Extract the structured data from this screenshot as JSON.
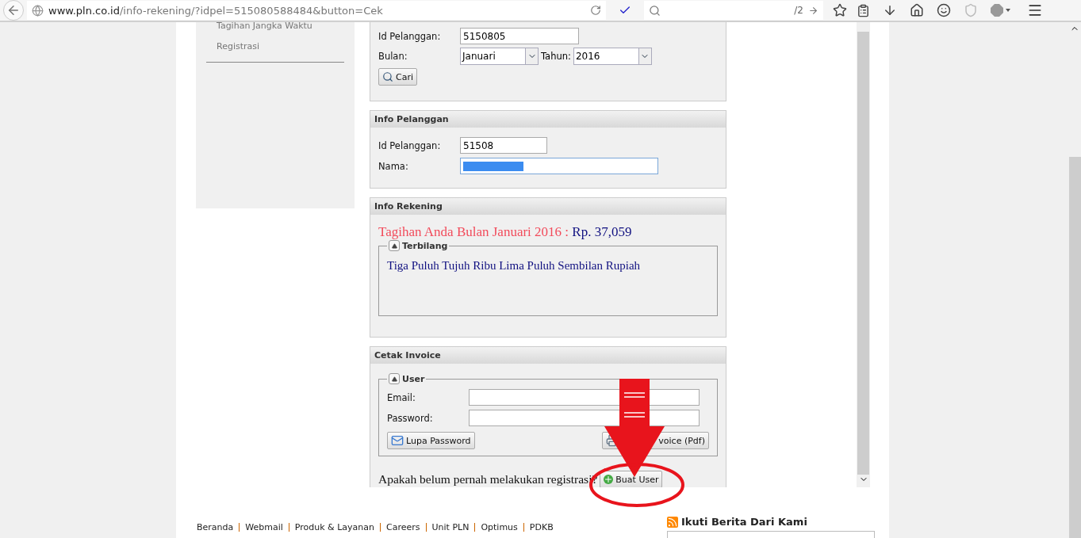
{
  "browser": {
    "url_host": "www.pln.co.id",
    "url_path": "/info-rekening/?idpel=515080588484&button=Cek",
    "search_text": "/2"
  },
  "sidebar": {
    "items": [
      "Tagihan Jangka Waktu",
      "Registrasi"
    ]
  },
  "search_form": {
    "id_label": "Id Pelanggan:",
    "id_value": "5150805",
    "month_label": "Bulan:",
    "month_value": "Januari",
    "year_label": "Tahun:",
    "year_value": "2016",
    "button": "Cari"
  },
  "info_pelanggan": {
    "title": "Info Pelanggan",
    "id_label": "Id Pelanggan:",
    "id_value": "51508",
    "name_label": "Nama:"
  },
  "info_rekening": {
    "title": "Info Rekening",
    "bill_text": "Tagihan Anda Bulan Januari 2016 :",
    "amount": "Rp. 37,059",
    "legend": "Terbilang",
    "words": "Tiga Puluh Tujuh Ribu Lima Puluh Sembilan Rupiah"
  },
  "cetak_invoice": {
    "title": "Cetak Invoice",
    "legend": "User",
    "email_label": "Email:",
    "password_label": "Password:",
    "forgot_button": "Lupa Password",
    "print_button": "voice (Pdf)",
    "register_question": "Apakah belum pernah melakukan registrasi?",
    "register_button": "Buat User"
  },
  "footer": {
    "links": [
      "Beranda",
      "Webmail",
      "Produk & Layanan",
      "Careers",
      "Unit PLN",
      "Optimus",
      "PDKB"
    ],
    "feed_title": "Ikuti Berita Dari Kami"
  }
}
